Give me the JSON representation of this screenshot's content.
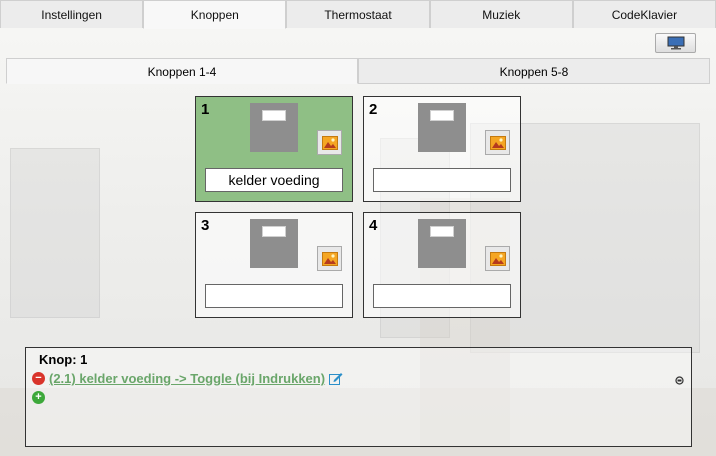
{
  "top_tabs": [
    "Instellingen",
    "Knoppen",
    "Thermostaat",
    "Muziek",
    "CodeKlavier"
  ],
  "active_top_tab": "Knoppen",
  "sub_tabs": [
    "Knoppen 1-4",
    "Knoppen 5-8"
  ],
  "active_sub_tab": "Knoppen 1-4",
  "buttons": [
    {
      "number": "1",
      "label": "kelder voeding",
      "active": true
    },
    {
      "number": "2",
      "label": "",
      "active": false
    },
    {
      "number": "3",
      "label": "",
      "active": false
    },
    {
      "number": "4",
      "label": "",
      "active": false
    }
  ],
  "info": {
    "title": "Knop: 1",
    "action_text": "(2.1) kelder voeding -> Toggle  (bij Indrukken)"
  },
  "icons": {
    "monitor": "monitor-icon",
    "image": "image-icon",
    "remove": "remove-icon",
    "add": "add-icon",
    "edit": "edit-icon",
    "small": "small-bell-icon"
  },
  "colors": {
    "active_button": "#8fbf85",
    "link": "#6aa66a",
    "remove": "#d9342b",
    "add": "#3da83a"
  }
}
